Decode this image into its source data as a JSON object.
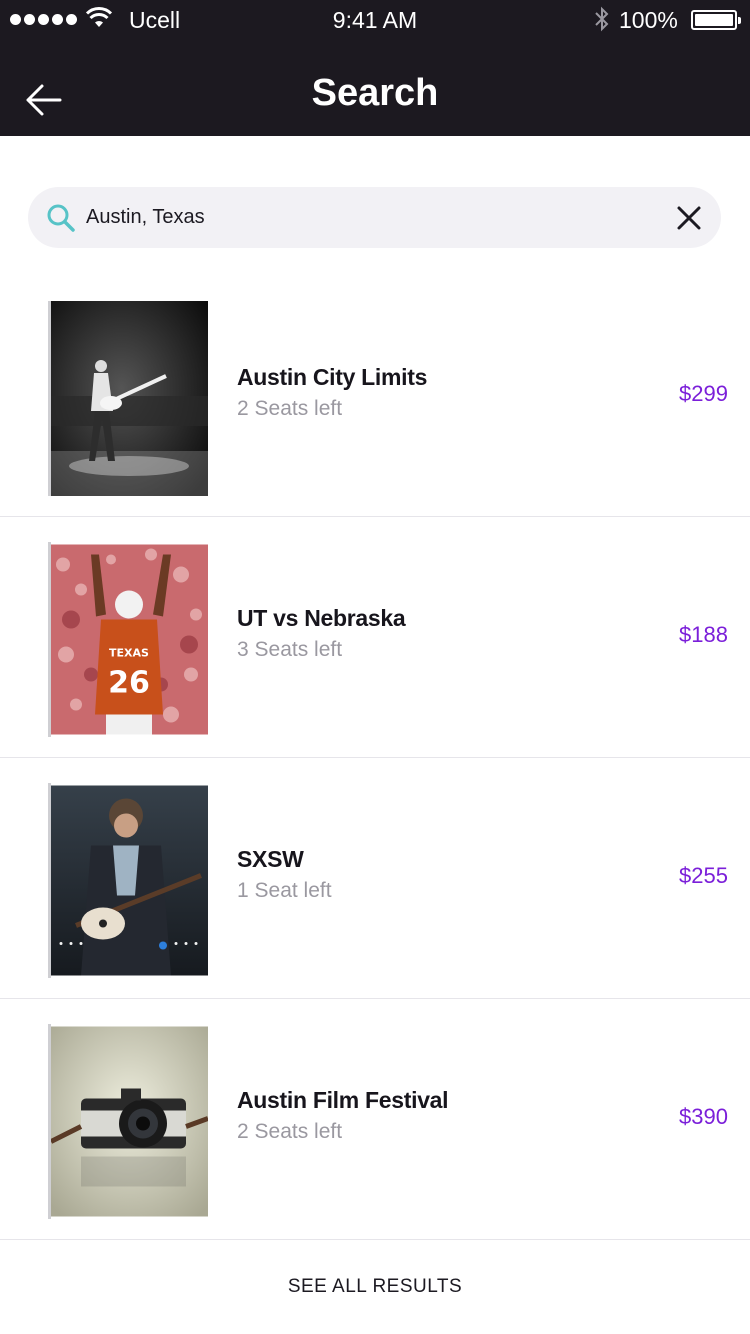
{
  "status_bar": {
    "carrier": "Ucell",
    "time": "9:41 AM",
    "battery": "100%"
  },
  "nav": {
    "title": "Search",
    "back_icon": "arrow-left-icon"
  },
  "search": {
    "value": "Austin, Texas",
    "search_icon": "search-icon",
    "clear_icon": "close-icon"
  },
  "results": [
    {
      "name": "Austin City Limits",
      "seats": "2 Seats left",
      "price": "$299"
    },
    {
      "name": "UT vs Nebraska",
      "seats": "3 Seats left",
      "price": "$188"
    },
    {
      "name": "SXSW",
      "seats": "1 Seat left",
      "price": "$255"
    },
    {
      "name": "Austin Film Festival",
      "seats": "2 Seats left",
      "price": "$390"
    }
  ],
  "footer": {
    "see_all_label": "SEE ALL RESULTS"
  },
  "colors": {
    "header_bg": "#1c1920",
    "price": "#7b1fd9",
    "search_icon": "#57c3c7"
  }
}
